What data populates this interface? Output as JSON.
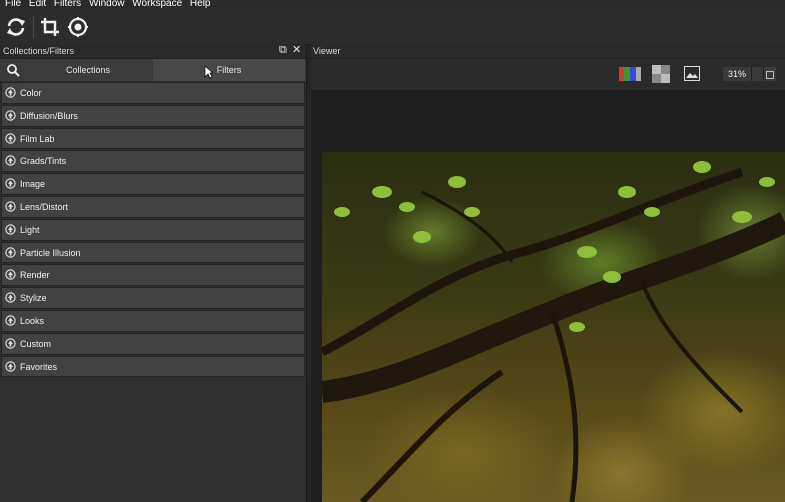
{
  "menu": {
    "items": [
      "File",
      "Edit",
      "Filters",
      "Window",
      "Workspace",
      "Help"
    ]
  },
  "toolbar": {
    "icons": [
      "refresh-icon",
      "crop-icon",
      "preview-icon"
    ]
  },
  "panel": {
    "title": "Collections/Filters",
    "tabs": {
      "collections": "Collections",
      "filters": "Filters"
    },
    "items": [
      "Color",
      "Diffusion/Blurs",
      "Film Lab",
      "Grads/Tints",
      "Image",
      "Lens/Distort",
      "Light",
      "Particle Illusion",
      "Render",
      "Stylize",
      "Looks",
      "Custom",
      "Favorites"
    ]
  },
  "viewer": {
    "title": "Viewer",
    "zoom": "31%"
  }
}
